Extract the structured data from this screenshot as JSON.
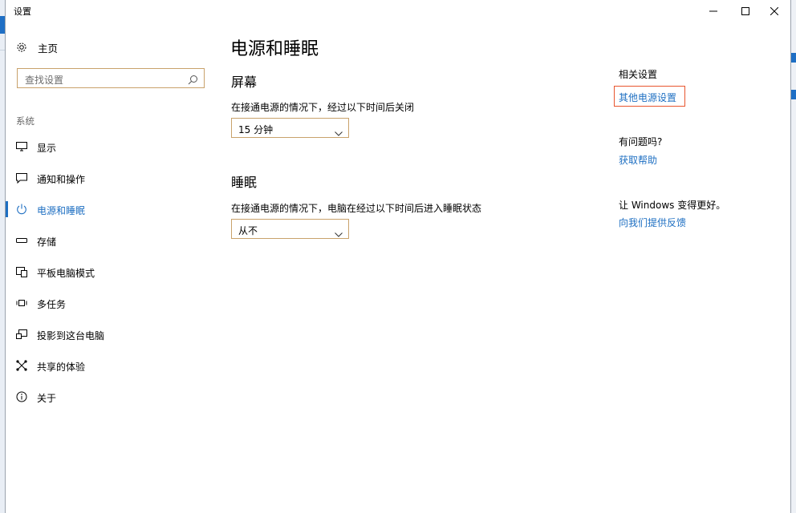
{
  "window": {
    "title": "设置"
  },
  "sidebar": {
    "home_label": "主页",
    "search_placeholder": "查找设置",
    "group_label": "系统",
    "items": [
      {
        "label": "显示",
        "icon": "monitor-icon"
      },
      {
        "label": "通知和操作",
        "icon": "notification-icon"
      },
      {
        "label": "电源和睡眠",
        "icon": "power-icon",
        "active": true
      },
      {
        "label": "存储",
        "icon": "storage-icon"
      },
      {
        "label": "平板电脑模式",
        "icon": "tablet-mode-icon"
      },
      {
        "label": "多任务",
        "icon": "multitasking-icon"
      },
      {
        "label": "投影到这台电脑",
        "icon": "projecting-icon"
      },
      {
        "label": "共享的体验",
        "icon": "shared-experiences-icon"
      },
      {
        "label": "关于",
        "icon": "info-icon"
      }
    ]
  },
  "main": {
    "title": "电源和睡眠",
    "screen": {
      "heading": "屏幕",
      "description": "在接通电源的情况下，经过以下时间后关闭",
      "selected": "15 分钟"
    },
    "sleep": {
      "heading": "睡眠",
      "description": "在接通电源的情况下，电脑在经过以下时间后进入睡眠状态",
      "selected": "从不"
    }
  },
  "related": {
    "heading": "相关设置",
    "link": "其他电源设置",
    "question_heading": "有问题吗?",
    "help_link": "获取帮助",
    "feedback_heading": "让 Windows 变得更好。",
    "feedback_link": "向我们提供反馈"
  },
  "colors": {
    "accent": "#1e6fc2",
    "highlight_border": "#e8552e",
    "input_border": "#c9a26b"
  }
}
